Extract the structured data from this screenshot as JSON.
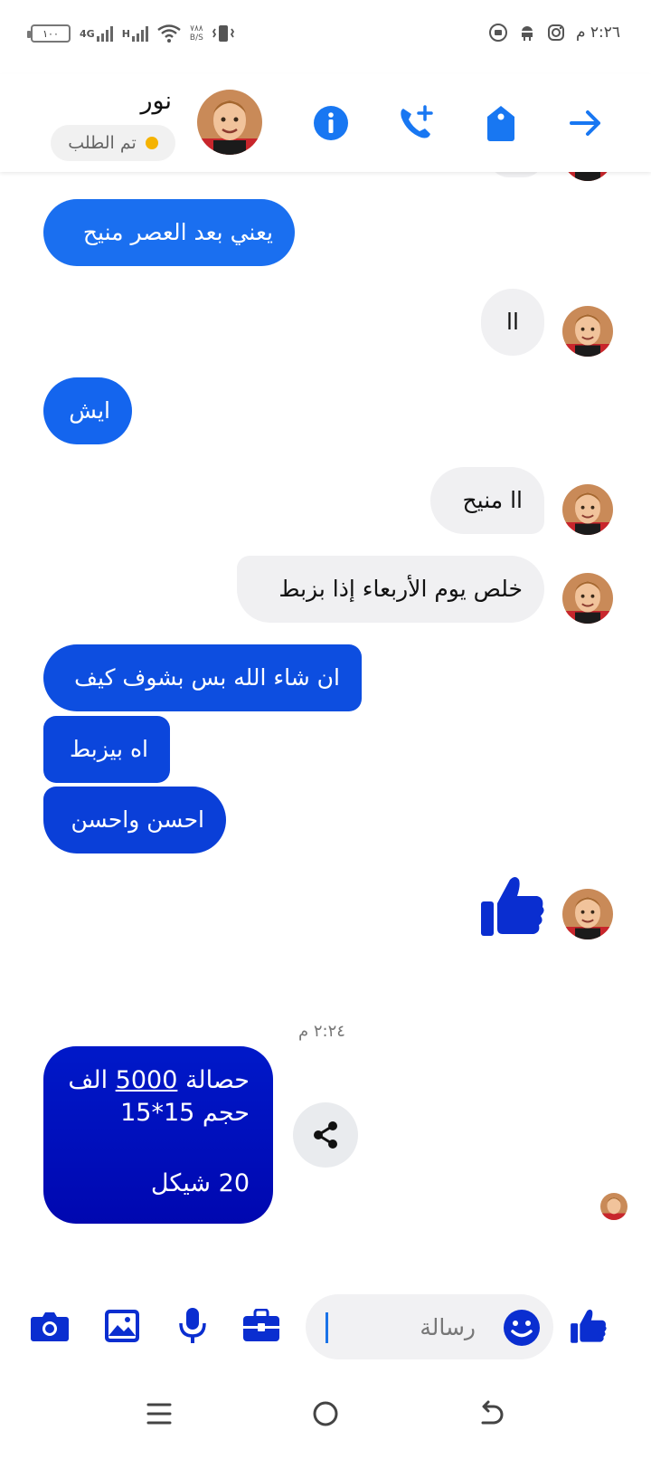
{
  "status_bar": {
    "time": "٢:٢٦ م",
    "battery": "١٠٠",
    "network_1": "4G",
    "network_2": "H",
    "speed_value": "٧٨٨",
    "speed_unit": "B/S"
  },
  "header": {
    "contact_name": "نور",
    "status_text": "تم الطلب",
    "status_color": "#f5b301",
    "icons": [
      "info-icon",
      "add-call-icon",
      "tag-icon",
      "forward-arrow-icon"
    ],
    "accent": "#1877f2"
  },
  "messages": [
    {
      "side": "out",
      "text": "يعني بعد العصر منيح",
      "color": "#1a6ff0"
    },
    {
      "side": "in",
      "text": "اا"
    },
    {
      "side": "out",
      "text": "ايش",
      "color": "#1465ee"
    },
    {
      "side": "in",
      "text": "اا منيح"
    },
    {
      "side": "in",
      "text": "خلص يوم الأربعاء إذا بزبط"
    },
    {
      "side": "out",
      "text": "ان شاء الله بس بشوف كيف",
      "color": "#0d4ee0"
    },
    {
      "side": "out",
      "text": "اه بيزبط",
      "color": "#0b46dc"
    },
    {
      "side": "out",
      "text": "احسن واحسن",
      "color": "#0a3fd8"
    },
    {
      "side": "in",
      "type": "like"
    },
    {
      "side": "out",
      "lines": [
        "حصالة 5000 الف",
        "حجم 15*15",
        "",
        "20 شيكل"
      ],
      "underlined": "5000",
      "color": "#0013c2"
    }
  ],
  "timestamp": "٢:٢٤ م",
  "composer": {
    "placeholder": "رسالة",
    "icons": [
      "camera-icon",
      "gallery-icon",
      "microphone-icon",
      "toolbox-icon",
      "emoji-icon",
      "like-icon"
    ]
  },
  "nav": {
    "buttons": [
      "menu-icon",
      "home-icon",
      "back-icon"
    ]
  }
}
